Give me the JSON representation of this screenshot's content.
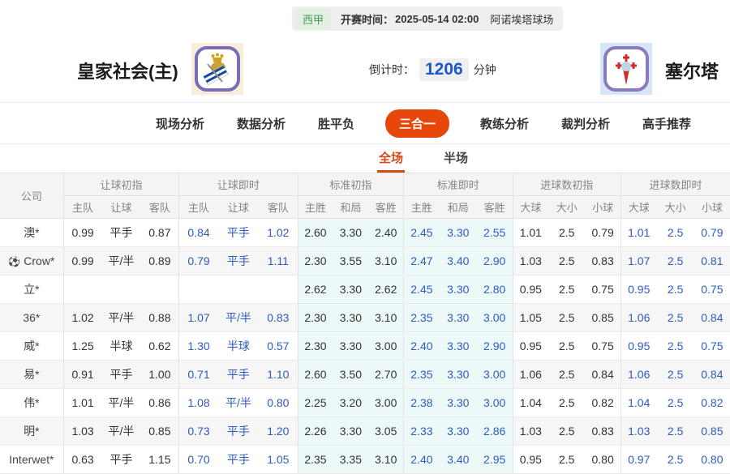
{
  "header": {
    "league": "西甲",
    "kickoff_label": "开赛时间：",
    "kickoff_time": "2025-05-14 02:00",
    "venue": "阿诺埃塔球场",
    "home_team": "皇家社会(主)",
    "away_team": "塞尔塔",
    "countdown_label": "倒计时：",
    "countdown_value": "1206",
    "countdown_unit": "分钟"
  },
  "nav": {
    "tabs": [
      {
        "label": "现场分析",
        "active": false
      },
      {
        "label": "数据分析",
        "active": false
      },
      {
        "label": "胜平负",
        "active": false
      },
      {
        "label": "三合一",
        "active": true
      },
      {
        "label": "教练分析",
        "active": false
      },
      {
        "label": "裁判分析",
        "active": false
      },
      {
        "label": "高手推荐",
        "active": false
      }
    ]
  },
  "subtabs": [
    {
      "label": "全场",
      "active": true
    },
    {
      "label": "半场",
      "active": false
    }
  ],
  "table": {
    "company_header": "公司",
    "groups": [
      {
        "title": "让球初指",
        "cols": [
          "主队",
          "让球",
          "客队"
        ]
      },
      {
        "title": "让球即时",
        "cols": [
          "主队",
          "让球",
          "客队"
        ]
      },
      {
        "title": "标准初指",
        "cols": [
          "主胜",
          "和局",
          "客胜"
        ]
      },
      {
        "title": "标准即时",
        "cols": [
          "主胜",
          "和局",
          "客胜"
        ]
      },
      {
        "title": "进球数初指",
        "cols": [
          "大球",
          "大小",
          "小球"
        ]
      },
      {
        "title": "进球数即时",
        "cols": [
          "大球",
          "大小",
          "小球"
        ]
      }
    ],
    "rows": [
      {
        "company": "澳*",
        "has_icon": false,
        "values": [
          "0.99",
          "平手",
          "0.87",
          "0.84",
          "平手",
          "1.02",
          "2.60",
          "3.30",
          "2.40",
          "2.45",
          "3.30",
          "2.55",
          "1.01",
          "2.5",
          "0.79",
          "1.01",
          "2.5",
          "0.79"
        ]
      },
      {
        "company": "Crow*",
        "has_icon": true,
        "values": [
          "0.99",
          "平/半",
          "0.89",
          "0.79",
          "平手",
          "1.11",
          "2.30",
          "3.55",
          "3.10",
          "2.47",
          "3.40",
          "2.90",
          "1.03",
          "2.5",
          "0.83",
          "1.07",
          "2.5",
          "0.81"
        ]
      },
      {
        "company": "立*",
        "has_icon": false,
        "values": [
          "",
          "",
          "",
          "",
          "",
          "",
          "2.62",
          "3.30",
          "2.62",
          "2.45",
          "3.30",
          "2.80",
          "0.95",
          "2.5",
          "0.75",
          "0.95",
          "2.5",
          "0.75"
        ]
      },
      {
        "company": "36*",
        "has_icon": false,
        "values": [
          "1.02",
          "平/半",
          "0.88",
          "1.07",
          "平/半",
          "0.83",
          "2.30",
          "3.30",
          "3.10",
          "2.35",
          "3.30",
          "3.00",
          "1.05",
          "2.5",
          "0.85",
          "1.06",
          "2.5",
          "0.84"
        ]
      },
      {
        "company": "威*",
        "has_icon": false,
        "values": [
          "1.25",
          "半球",
          "0.62",
          "1.30",
          "半球",
          "0.57",
          "2.30",
          "3.30",
          "3.00",
          "2.40",
          "3.30",
          "2.90",
          "0.95",
          "2.5",
          "0.75",
          "0.95",
          "2.5",
          "0.75"
        ]
      },
      {
        "company": "易*",
        "has_icon": false,
        "values": [
          "0.91",
          "平手",
          "1.00",
          "0.71",
          "平手",
          "1.10",
          "2.60",
          "3.50",
          "2.70",
          "2.35",
          "3.30",
          "3.00",
          "1.06",
          "2.5",
          "0.84",
          "1.06",
          "2.5",
          "0.84"
        ]
      },
      {
        "company": "伟*",
        "has_icon": false,
        "values": [
          "1.01",
          "平/半",
          "0.86",
          "1.08",
          "平/半",
          "0.80",
          "2.25",
          "3.20",
          "3.00",
          "2.38",
          "3.30",
          "3.00",
          "1.04",
          "2.5",
          "0.82",
          "1.04",
          "2.5",
          "0.82"
        ]
      },
      {
        "company": "明*",
        "has_icon": false,
        "values": [
          "1.03",
          "平/半",
          "0.85",
          "0.73",
          "平手",
          "1.20",
          "2.26",
          "3.30",
          "3.05",
          "2.33",
          "3.30",
          "2.86",
          "1.03",
          "2.5",
          "0.83",
          "1.03",
          "2.5",
          "0.85"
        ]
      },
      {
        "company": "Interwet*",
        "has_icon": false,
        "values": [
          "0.63",
          "平手",
          "1.15",
          "0.70",
          "平手",
          "1.05",
          "2.35",
          "3.35",
          "3.10",
          "2.40",
          "3.40",
          "2.95",
          "0.95",
          "2.5",
          "0.80",
          "0.97",
          "2.5",
          "0.80"
        ]
      }
    ]
  },
  "colors": {
    "accent_orange": "#e8470b",
    "link_blue": "#2e5cbe",
    "countdown_blue": "#1b57c9",
    "league_green": "#4a9a5e",
    "cyan_col_bg": "#edf9f9"
  }
}
